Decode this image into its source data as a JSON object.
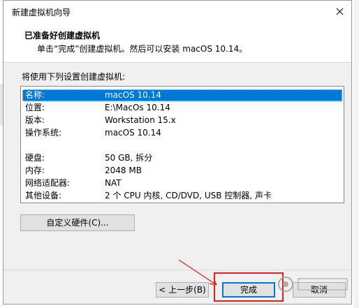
{
  "window": {
    "title": "新建虚拟机向导"
  },
  "header": {
    "title": "已准备好创建虚拟机",
    "subtitle": "单击“完成”创建虚拟机。然后可以安装 macOS 10.14。"
  },
  "settings": {
    "label": "将使用下列设置创建虚拟机:",
    "rows": [
      {
        "key": "名称:",
        "value": "macOS 10.14",
        "selected": true
      },
      {
        "key": "位置:",
        "value": "E:\\MacOs 10.14"
      },
      {
        "key": "版本:",
        "value": "Workstation 15.x"
      },
      {
        "key": "操作系统:",
        "value": "macOS 10.14"
      },
      {
        "key": "硬盘:",
        "value": "50 GB, 拆分"
      },
      {
        "key": "内存:",
        "value": "2048 MB"
      },
      {
        "key": "网络适配器:",
        "value": "NAT"
      },
      {
        "key": "其他设备:",
        "value": "2 个 CPU 内核, CD/DVD, USB 控制器, 声卡"
      }
    ]
  },
  "buttons": {
    "customize": "自定义硬件(C)...",
    "back": "< 上一步(B)",
    "finish": "完成",
    "cancel": "取消"
  },
  "icons": {
    "close": "close-icon"
  },
  "colors": {
    "selection": "#0078d7",
    "highlight": "#e02020"
  }
}
